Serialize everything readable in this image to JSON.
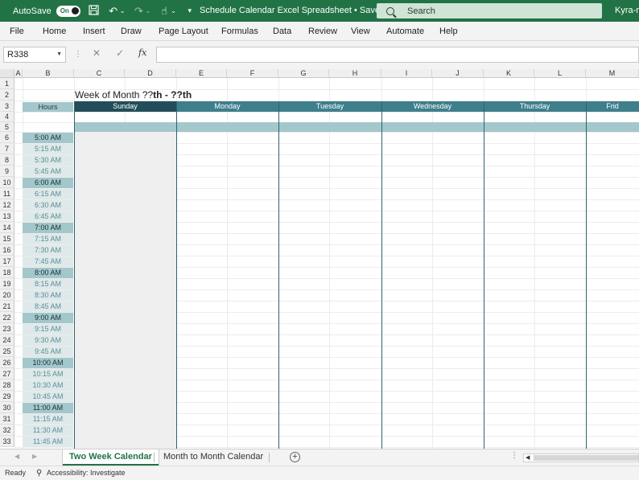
{
  "titlebar": {
    "autosave_label": "AutoSave",
    "autosave_state": "On",
    "doc_title": "Schedule Calendar Excel Spreadsheet • Saved",
    "search_placeholder": "Search",
    "user": "Kyra-m"
  },
  "ribbon": {
    "tabs": [
      "File",
      "Home",
      "Insert",
      "Draw",
      "Page Layout",
      "Formulas",
      "Data",
      "Review",
      "View",
      "Automate",
      "Help"
    ]
  },
  "formula_bar": {
    "name_box": "R338",
    "fx_label": "fx",
    "formula": ""
  },
  "grid": {
    "columns": [
      "A",
      "B",
      "C",
      "D",
      "E",
      "F",
      "G",
      "H",
      "I",
      "J",
      "K",
      "L",
      "M"
    ],
    "rows": [
      "1",
      "2",
      "3",
      "4",
      "5",
      "6",
      "7",
      "8",
      "9",
      "10",
      "11",
      "12",
      "13",
      "14",
      "15",
      "16",
      "17",
      "18",
      "19",
      "20",
      "21",
      "22",
      "23",
      "24",
      "25",
      "26",
      "27",
      "28",
      "29",
      "30",
      "31",
      "32",
      "33"
    ],
    "week_title_prefix": "Week of Month ??",
    "week_title_bold": "th - ??th",
    "hours_header": "Hours",
    "days": [
      "Sunday",
      "Monday",
      "Tuesday",
      "Wednesday",
      "Thursday",
      "Frid"
    ],
    "times": [
      {
        "label": "5:00 AM",
        "hour": true
      },
      {
        "label": "5:15 AM",
        "hour": false
      },
      {
        "label": "5:30 AM",
        "hour": false
      },
      {
        "label": "5:45 AM",
        "hour": false
      },
      {
        "label": "6:00 AM",
        "hour": true
      },
      {
        "label": "6:15 AM",
        "hour": false
      },
      {
        "label": "6:30 AM",
        "hour": false
      },
      {
        "label": "6:45 AM",
        "hour": false
      },
      {
        "label": "7:00 AM",
        "hour": true
      },
      {
        "label": "7:15 AM",
        "hour": false
      },
      {
        "label": "7:30 AM",
        "hour": false
      },
      {
        "label": "7:45 AM",
        "hour": false
      },
      {
        "label": "8:00 AM",
        "hour": true
      },
      {
        "label": "8:15 AM",
        "hour": false
      },
      {
        "label": "8:30 AM",
        "hour": false
      },
      {
        "label": "8:45 AM",
        "hour": false
      },
      {
        "label": "9:00 AM",
        "hour": true
      },
      {
        "label": "9:15 AM",
        "hour": false
      },
      {
        "label": "9:30 AM",
        "hour": false
      },
      {
        "label": "9:45 AM",
        "hour": false
      },
      {
        "label": "10:00 AM",
        "hour": true
      },
      {
        "label": "10:15 AM",
        "hour": false
      },
      {
        "label": "10:30 AM",
        "hour": false
      },
      {
        "label": "10:45 AM",
        "hour": false
      },
      {
        "label": "11:00 AM",
        "hour": true
      },
      {
        "label": "11:15 AM",
        "hour": false
      },
      {
        "label": "11:30 AM",
        "hour": false
      },
      {
        "label": "11:45 AM",
        "hour": false
      }
    ]
  },
  "sheets": {
    "tabs": [
      "Two Week Calendar",
      "Month to Month Calendar"
    ],
    "active": "Two Week Calendar",
    "add_symbol": "+"
  },
  "status": {
    "ready": "Ready",
    "accessibility": "Accessibility: Investigate"
  },
  "colors": {
    "excel_green": "#217346",
    "header_teal": "#3f7f8c",
    "header_dark": "#234e59",
    "band_light": "#a4c7cb",
    "sub_time_bg": "#dfe9ea"
  }
}
